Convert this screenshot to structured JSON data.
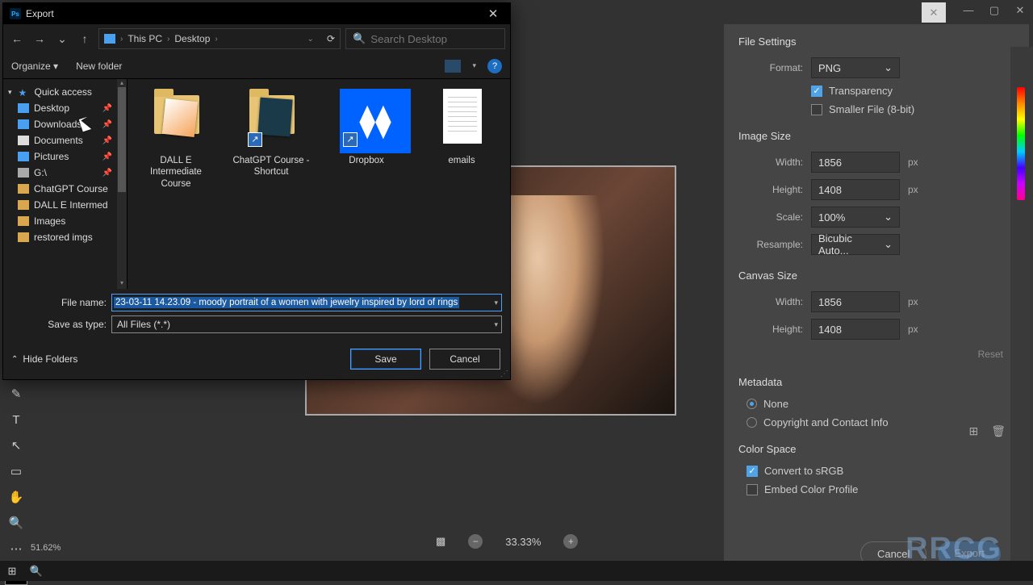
{
  "app": {
    "dialog_title": "Export",
    "nav": {
      "crumbs": [
        "This PC",
        "Desktop"
      ],
      "search_placeholder": "Search Desktop"
    },
    "toolbar": {
      "organize": "Organize",
      "new_folder": "New folder"
    },
    "sidebar": {
      "quick_access": "Quick access",
      "items": [
        {
          "label": "Desktop",
          "pinned": true
        },
        {
          "label": "Downloads",
          "pinned": true
        },
        {
          "label": "Documents",
          "pinned": true
        },
        {
          "label": "Pictures",
          "pinned": true
        },
        {
          "label": "G:\\",
          "pinned": true
        },
        {
          "label": "ChatGPT Course",
          "pinned": false
        },
        {
          "label": "DALL E Intermed",
          "pinned": false
        },
        {
          "label": "Images",
          "pinned": false
        },
        {
          "label": "restored imgs",
          "pinned": false
        }
      ]
    },
    "files": [
      {
        "label": "DALL E Intermediate Course",
        "type": "folder-thumb1"
      },
      {
        "label": "ChatGPT Course - Shortcut",
        "type": "folder-thumb2-shortcut"
      },
      {
        "label": "Dropbox",
        "type": "dropbox-shortcut"
      },
      {
        "label": "emails",
        "type": "doc"
      }
    ],
    "filename_label": "File name:",
    "filename_value": "23-03-11 14.23.09 - moody portrait of a women with jewelry inspired by lord of rings ",
    "type_label": "Save as type:",
    "type_value": "All Files (*.*)",
    "hide_folders": "Hide Folders",
    "save": "Save",
    "cancel": "Cancel"
  },
  "export_panel": {
    "file_settings": "File Settings",
    "format_label": "Format:",
    "format_value": "PNG",
    "transparency": "Transparency",
    "smaller_file": "Smaller File (8-bit)",
    "image_size": "Image Size",
    "width_label": "Width:",
    "width_value": "1856",
    "height_label": "Height:",
    "height_value": "1408",
    "scale_label": "Scale:",
    "scale_value": "100%",
    "resample_label": "Resample:",
    "resample_value": "Bicubic Auto...",
    "canvas_size": "Canvas Size",
    "c_width": "1856",
    "c_height": "1408",
    "reset": "Reset",
    "metadata": "Metadata",
    "meta_none": "None",
    "meta_copy": "Copyright and Contact Info",
    "color_space": "Color Space",
    "convert_srgb": "Convert to sRGB",
    "embed_profile": "Embed Color Profile",
    "px": "px",
    "bottom_cancel": "Cancel",
    "bottom_export": "Export"
  },
  "preview": {
    "zoom": "33.33%",
    "statusbar_zoom": "51.62%"
  },
  "watermark": "RRCG"
}
